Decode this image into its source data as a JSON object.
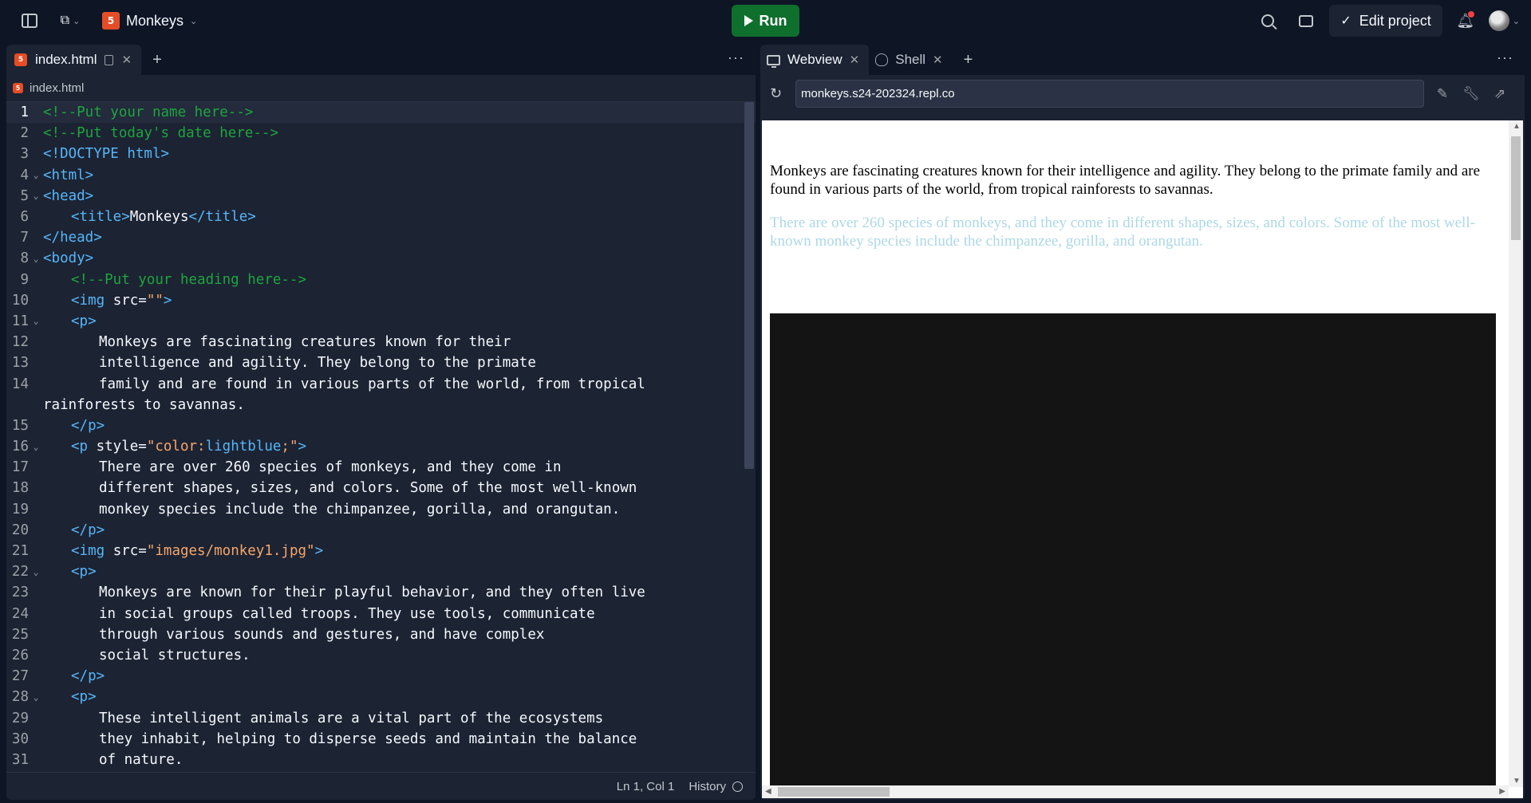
{
  "topbar": {
    "project_name": "Monkeys",
    "run_label": "Run",
    "edit_project_label": "Edit project"
  },
  "editor": {
    "tab_label": "index.html",
    "breadcrumb": "index.html",
    "status_position": "Ln 1, Col 1",
    "history_label": "History"
  },
  "code_lines": [
    {
      "n": "1",
      "fold": "",
      "indent": 0,
      "parts": [
        [
          "c-com",
          "<!--Put your name here-->"
        ]
      ]
    },
    {
      "n": "2",
      "fold": "",
      "indent": 0,
      "parts": [
        [
          "c-com",
          "<!--Put today's date here-->"
        ]
      ]
    },
    {
      "n": "3",
      "fold": "",
      "indent": 0,
      "parts": [
        [
          "c-tag",
          "<!DOCTYPE html>"
        ]
      ]
    },
    {
      "n": "4",
      "fold": "⌄",
      "indent": 0,
      "parts": [
        [
          "c-tag",
          "<html>"
        ]
      ]
    },
    {
      "n": "5",
      "fold": "⌄",
      "indent": 0,
      "parts": [
        [
          "c-tag",
          "<head>"
        ]
      ]
    },
    {
      "n": "6",
      "fold": "",
      "indent": 1,
      "parts": [
        [
          "c-tag",
          "<title>"
        ],
        [
          "c-txt",
          "Monkeys"
        ],
        [
          "c-tag",
          "</title>"
        ]
      ]
    },
    {
      "n": "7",
      "fold": "",
      "indent": 0,
      "parts": [
        [
          "c-tag",
          "</head>"
        ]
      ]
    },
    {
      "n": "8",
      "fold": "⌄",
      "indent": 0,
      "parts": [
        [
          "c-tag",
          "<body>"
        ]
      ]
    },
    {
      "n": "9",
      "fold": "",
      "indent": 1,
      "parts": [
        [
          "c-com",
          "<!--Put your heading here-->"
        ]
      ]
    },
    {
      "n": "10",
      "fold": "",
      "indent": 1,
      "parts": [
        [
          "c-tag",
          "<img "
        ],
        [
          "c-attr",
          "src="
        ],
        [
          "c-str",
          "\"\""
        ],
        [
          "c-tag",
          ">"
        ]
      ]
    },
    {
      "n": "11",
      "fold": "⌄",
      "indent": 1,
      "parts": [
        [
          "c-tag",
          "<p>"
        ]
      ]
    },
    {
      "n": "12",
      "fold": "",
      "indent": 2,
      "parts": [
        [
          "c-txt",
          "Monkeys are fascinating creatures known for their"
        ]
      ]
    },
    {
      "n": "13",
      "fold": "",
      "indent": 2,
      "parts": [
        [
          "c-txt",
          "intelligence and agility. They belong to the primate"
        ]
      ]
    },
    {
      "n": "14",
      "fold": "",
      "indent": 2,
      "parts": [
        [
          "c-txt",
          "family and are found in various parts of the world, from tropical"
        ]
      ]
    },
    {
      "n": "",
      "fold": "",
      "indent": 0,
      "parts": [
        [
          "c-txt",
          "rainforests to savannas."
        ]
      ]
    },
    {
      "n": "15",
      "fold": "",
      "indent": 1,
      "parts": [
        [
          "c-tag",
          "</p>"
        ]
      ]
    },
    {
      "n": "16",
      "fold": "⌄",
      "indent": 1,
      "parts": [
        [
          "c-tag",
          "<p "
        ],
        [
          "c-attr",
          "style="
        ],
        [
          "c-str",
          "\"color:"
        ],
        [
          "c-tag",
          "lightblue"
        ],
        [
          "c-str",
          ";\""
        ],
        [
          "c-tag",
          ">"
        ]
      ]
    },
    {
      "n": "17",
      "fold": "",
      "indent": 2,
      "parts": [
        [
          "c-txt",
          "There are over 260 species of monkeys, and they come in"
        ]
      ]
    },
    {
      "n": "18",
      "fold": "",
      "indent": 2,
      "parts": [
        [
          "c-txt",
          "different shapes, sizes, and colors. Some of the most well-known"
        ]
      ]
    },
    {
      "n": "19",
      "fold": "",
      "indent": 2,
      "parts": [
        [
          "c-txt",
          "monkey species include the chimpanzee, gorilla, and orangutan."
        ]
      ]
    },
    {
      "n": "20",
      "fold": "",
      "indent": 1,
      "parts": [
        [
          "c-tag",
          "</p>"
        ]
      ]
    },
    {
      "n": "21",
      "fold": "",
      "indent": 1,
      "parts": [
        [
          "c-tag",
          "<img "
        ],
        [
          "c-attr",
          "src="
        ],
        [
          "c-str",
          "\"images/monkey1.jpg\""
        ],
        [
          "c-tag",
          ">"
        ]
      ]
    },
    {
      "n": "22",
      "fold": "⌄",
      "indent": 1,
      "parts": [
        [
          "c-tag",
          "<p>"
        ]
      ]
    },
    {
      "n": "23",
      "fold": "",
      "indent": 2,
      "parts": [
        [
          "c-txt",
          "Monkeys are known for their playful behavior, and they often live"
        ]
      ]
    },
    {
      "n": "24",
      "fold": "",
      "indent": 2,
      "parts": [
        [
          "c-txt",
          "in social groups called troops. They use tools, communicate"
        ]
      ]
    },
    {
      "n": "25",
      "fold": "",
      "indent": 2,
      "parts": [
        [
          "c-txt",
          "through various sounds and gestures, and have complex"
        ]
      ]
    },
    {
      "n": "26",
      "fold": "",
      "indent": 2,
      "parts": [
        [
          "c-txt",
          "social structures."
        ]
      ]
    },
    {
      "n": "27",
      "fold": "",
      "indent": 1,
      "parts": [
        [
          "c-tag",
          "</p>"
        ]
      ]
    },
    {
      "n": "28",
      "fold": "⌄",
      "indent": 1,
      "parts": [
        [
          "c-tag",
          "<p>"
        ]
      ]
    },
    {
      "n": "29",
      "fold": "",
      "indent": 2,
      "parts": [
        [
          "c-txt",
          "These intelligent animals are a vital part of the ecosystems"
        ]
      ]
    },
    {
      "n": "30",
      "fold": "",
      "indent": 2,
      "parts": [
        [
          "c-txt",
          "they inhabit, helping to disperse seeds and maintain the balance"
        ]
      ]
    },
    {
      "n": "31",
      "fold": "",
      "indent": 2,
      "parts": [
        [
          "c-txt",
          "of nature."
        ]
      ]
    }
  ],
  "right_panel": {
    "tabs": [
      {
        "label": "Webview",
        "icon": "monitor-icon"
      },
      {
        "label": "Shell",
        "icon": "shell-icon"
      }
    ],
    "url": "monkeys.s24-202324.repl.co"
  },
  "webview": {
    "p1": "Monkeys are fascinating creatures known for their intelligence and agility. They belong to the primate family and are found in various parts of the world, from tropical rainforests to savannas.",
    "p2": "There are over 260 species of monkeys, and they come in different shapes, sizes, and colors. Some of the most well-known monkey species include the chimpanzee, gorilla, and orangutan.",
    "p2_color": "#add8e6"
  }
}
